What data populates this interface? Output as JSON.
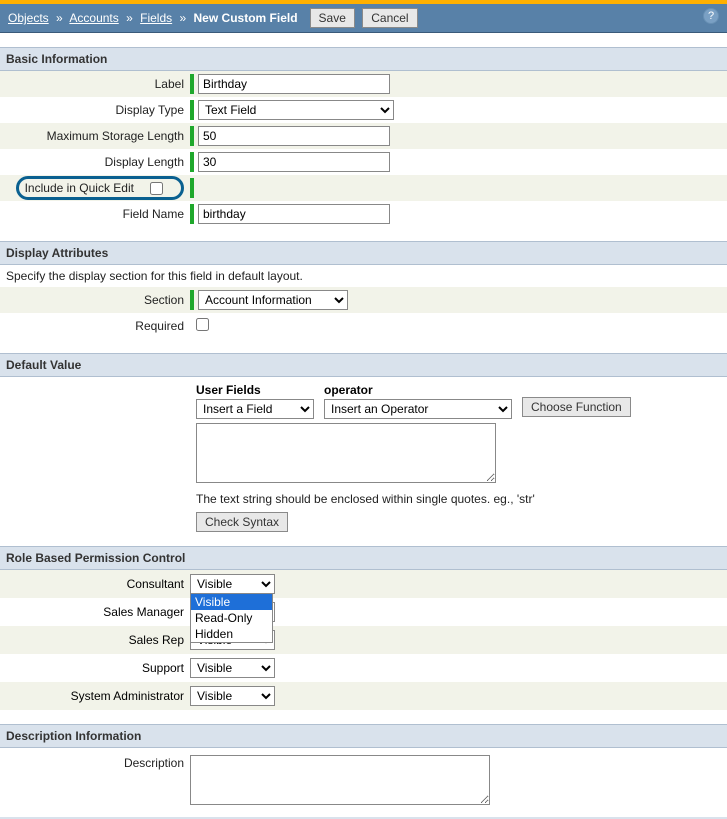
{
  "header": {
    "breadcrumb": {
      "objects": "Objects",
      "accounts": "Accounts",
      "fields": "Fields",
      "current": "New Custom Field"
    },
    "buttons": {
      "save": "Save",
      "cancel": "Cancel"
    },
    "help": "?"
  },
  "sections": {
    "basic": "Basic Information",
    "display_attrs": "Display Attributes",
    "default_value": "Default Value",
    "role_perm": "Role Based Permission Control",
    "desc_info": "Description Information"
  },
  "basic": {
    "label_lbl": "Label",
    "label_val": "Birthday",
    "display_type_lbl": "Display Type",
    "display_type_val": "Text Field",
    "max_storage_lbl": "Maximum Storage Length",
    "max_storage_val": "50",
    "display_length_lbl": "Display Length",
    "display_length_val": "30",
    "quick_edit_lbl": "Include in Quick Edit",
    "field_name_lbl": "Field Name",
    "field_name_val": "birthday"
  },
  "display_attrs": {
    "note": "Specify the display section for this field in default layout.",
    "section_lbl": "Section",
    "section_val": "Account Information",
    "required_lbl": "Required"
  },
  "default_value": {
    "user_fields_lbl": "User Fields",
    "user_fields_val": "Insert a Field",
    "operator_lbl": "operator",
    "operator_val": "Insert an Operator",
    "choose_function": "Choose Function",
    "hint": "The text string should be enclosed within single quotes. eg., 'str'",
    "check_syntax": "Check Syntax"
  },
  "roles": [
    {
      "label": "Consultant",
      "value": "Visible",
      "open": true
    },
    {
      "label": "Sales Manager",
      "value": "Visible"
    },
    {
      "label": "Sales Rep",
      "value": "Visible"
    },
    {
      "label": "Support",
      "value": "Visible"
    },
    {
      "label": "System Administrator",
      "value": "Visible"
    }
  ],
  "role_options": [
    "Visible",
    "Read-Only",
    "Hidden"
  ],
  "description": {
    "label": "Description"
  }
}
